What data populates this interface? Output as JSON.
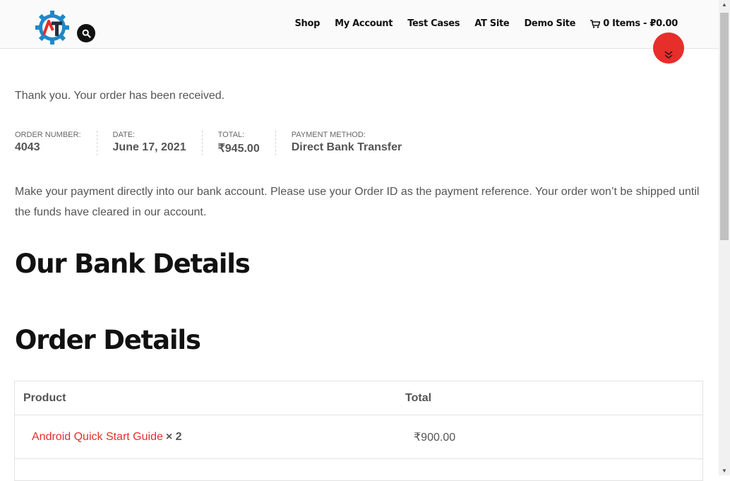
{
  "header": {
    "nav": [
      "Shop",
      "My Account",
      "Test Cases",
      "AT Site",
      "Demo Site"
    ],
    "cart_label": "0 Items - ₽0.00"
  },
  "colors": {
    "accent": "#e62e2b",
    "logo_blue": "#1e88c9",
    "logo_dark": "#1f2f3f"
  },
  "icons": {
    "search": "search-icon",
    "cart": "cart-icon",
    "scroll_down": "double-chevron-down-icon"
  },
  "thanks": "Thank you. Your order has been received.",
  "overview": [
    {
      "label": "ORDER NUMBER:",
      "value": "4043"
    },
    {
      "label": "DATE:",
      "value": "June 17, 2021"
    },
    {
      "label": "TOTAL:",
      "value": "₹945.00"
    },
    {
      "label": "PAYMENT METHOD:",
      "value": "Direct Bank Transfer"
    }
  ],
  "instructions": "Make your payment directly into our bank account. Please use your Order ID as the payment reference. Your order won’t be shipped until the funds have cleared in our account.",
  "bank_heading": "Our Bank Details",
  "order_heading": "Order Details",
  "table": {
    "headers": [
      "Product",
      "Total"
    ],
    "rows": [
      {
        "product": "Android Quick Start Guide",
        "qty": "× 2",
        "total": "₹900.00"
      }
    ]
  }
}
